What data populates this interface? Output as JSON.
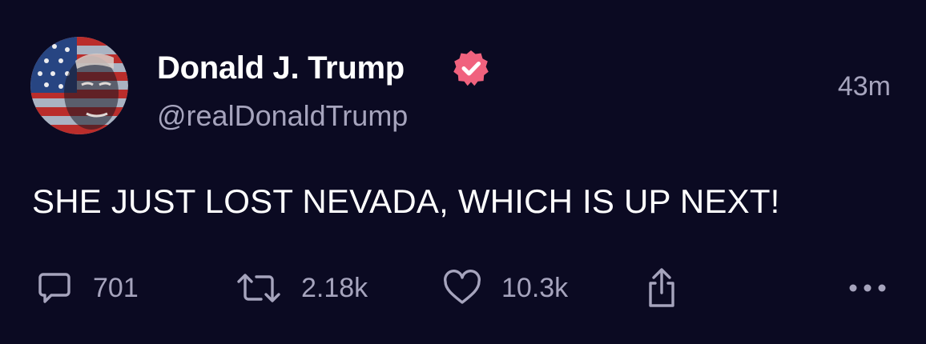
{
  "post": {
    "author": {
      "display_name": "Donald J. Trump",
      "handle": "@realDonaldTrump",
      "verified": true,
      "avatar_icon": "avatar-flag-portrait"
    },
    "timestamp": "43m",
    "text": "SHE JUST LOST NEVADA, WHICH IS UP NEXT!",
    "actions": {
      "reply_count": "701",
      "repost_count": "2.18k",
      "like_count": "10.3k"
    }
  },
  "colors": {
    "background": "#0b0a22",
    "primary_text": "#ffffff",
    "secondary_text": "#a6a4bd",
    "verified_badge": "#f0627e"
  },
  "icons": [
    "verified-badge-icon",
    "reply-icon",
    "repost-icon",
    "like-icon",
    "share-icon",
    "more-icon"
  ]
}
